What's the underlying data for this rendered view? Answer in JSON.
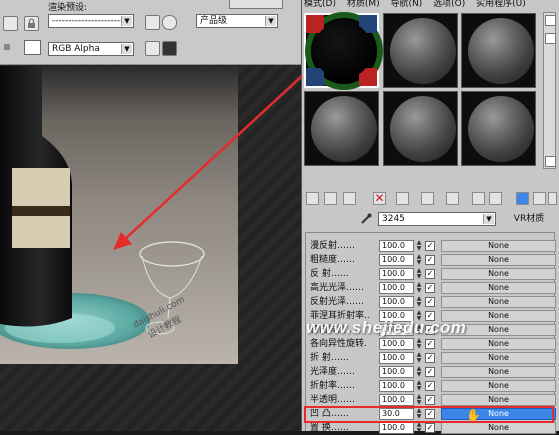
{
  "left_toolbar": {
    "preset_label": "渲染预设:",
    "preset_value": "------------------------",
    "level_value": "产品级",
    "channel_value": "RGB Alpha"
  },
  "render_watermark": {
    "site1": "daishuli.com",
    "site2": "设计教程"
  },
  "material_editor": {
    "menu": [
      "模式(D)",
      "材质(M)",
      "导航(N)",
      "选项(O)",
      "实用程序(U)"
    ],
    "material_name": "3245",
    "material_type": "VR材质",
    "params": [
      {
        "label": "漫反射……",
        "value": "100.0",
        "checked": true,
        "map": "None"
      },
      {
        "label": "粗糙度……",
        "value": "100.0",
        "checked": true,
        "map": "None"
      },
      {
        "label": "反  射……",
        "value": "100.0",
        "checked": true,
        "map": "None"
      },
      {
        "label": "高光光泽……",
        "value": "100.0",
        "checked": true,
        "map": "None"
      },
      {
        "label": "反射光泽……",
        "value": "100.0",
        "checked": true,
        "map": "None"
      },
      {
        "label": "菲涅耳折射率..",
        "value": "100.0",
        "checked": true,
        "map": "None"
      },
      {
        "label": "各向异性……",
        "value": "100.0",
        "checked": true,
        "map": "None"
      },
      {
        "label": "各向异性旋转.",
        "value": "100.0",
        "checked": true,
        "map": "None"
      },
      {
        "label": "折  射……",
        "value": "100.0",
        "checked": true,
        "map": "None"
      },
      {
        "label": "光泽度……",
        "value": "100.0",
        "checked": true,
        "map": "None"
      },
      {
        "label": "折射率……",
        "value": "100.0",
        "checked": true,
        "map": "None"
      },
      {
        "label": "半透明……",
        "value": "100.0",
        "checked": true,
        "map": "None"
      },
      {
        "label": "凹  凸……",
        "value": "30.0",
        "checked": true,
        "map": "None"
      },
      {
        "label": "置  换……",
        "value": "100.0",
        "checked": true,
        "map": "None"
      }
    ]
  },
  "watermark": "www.shejiedu.com",
  "colors": {
    "highlight": "#e52b2b",
    "selected_map": "#3b86e8",
    "panel": "#c7c7c7"
  }
}
